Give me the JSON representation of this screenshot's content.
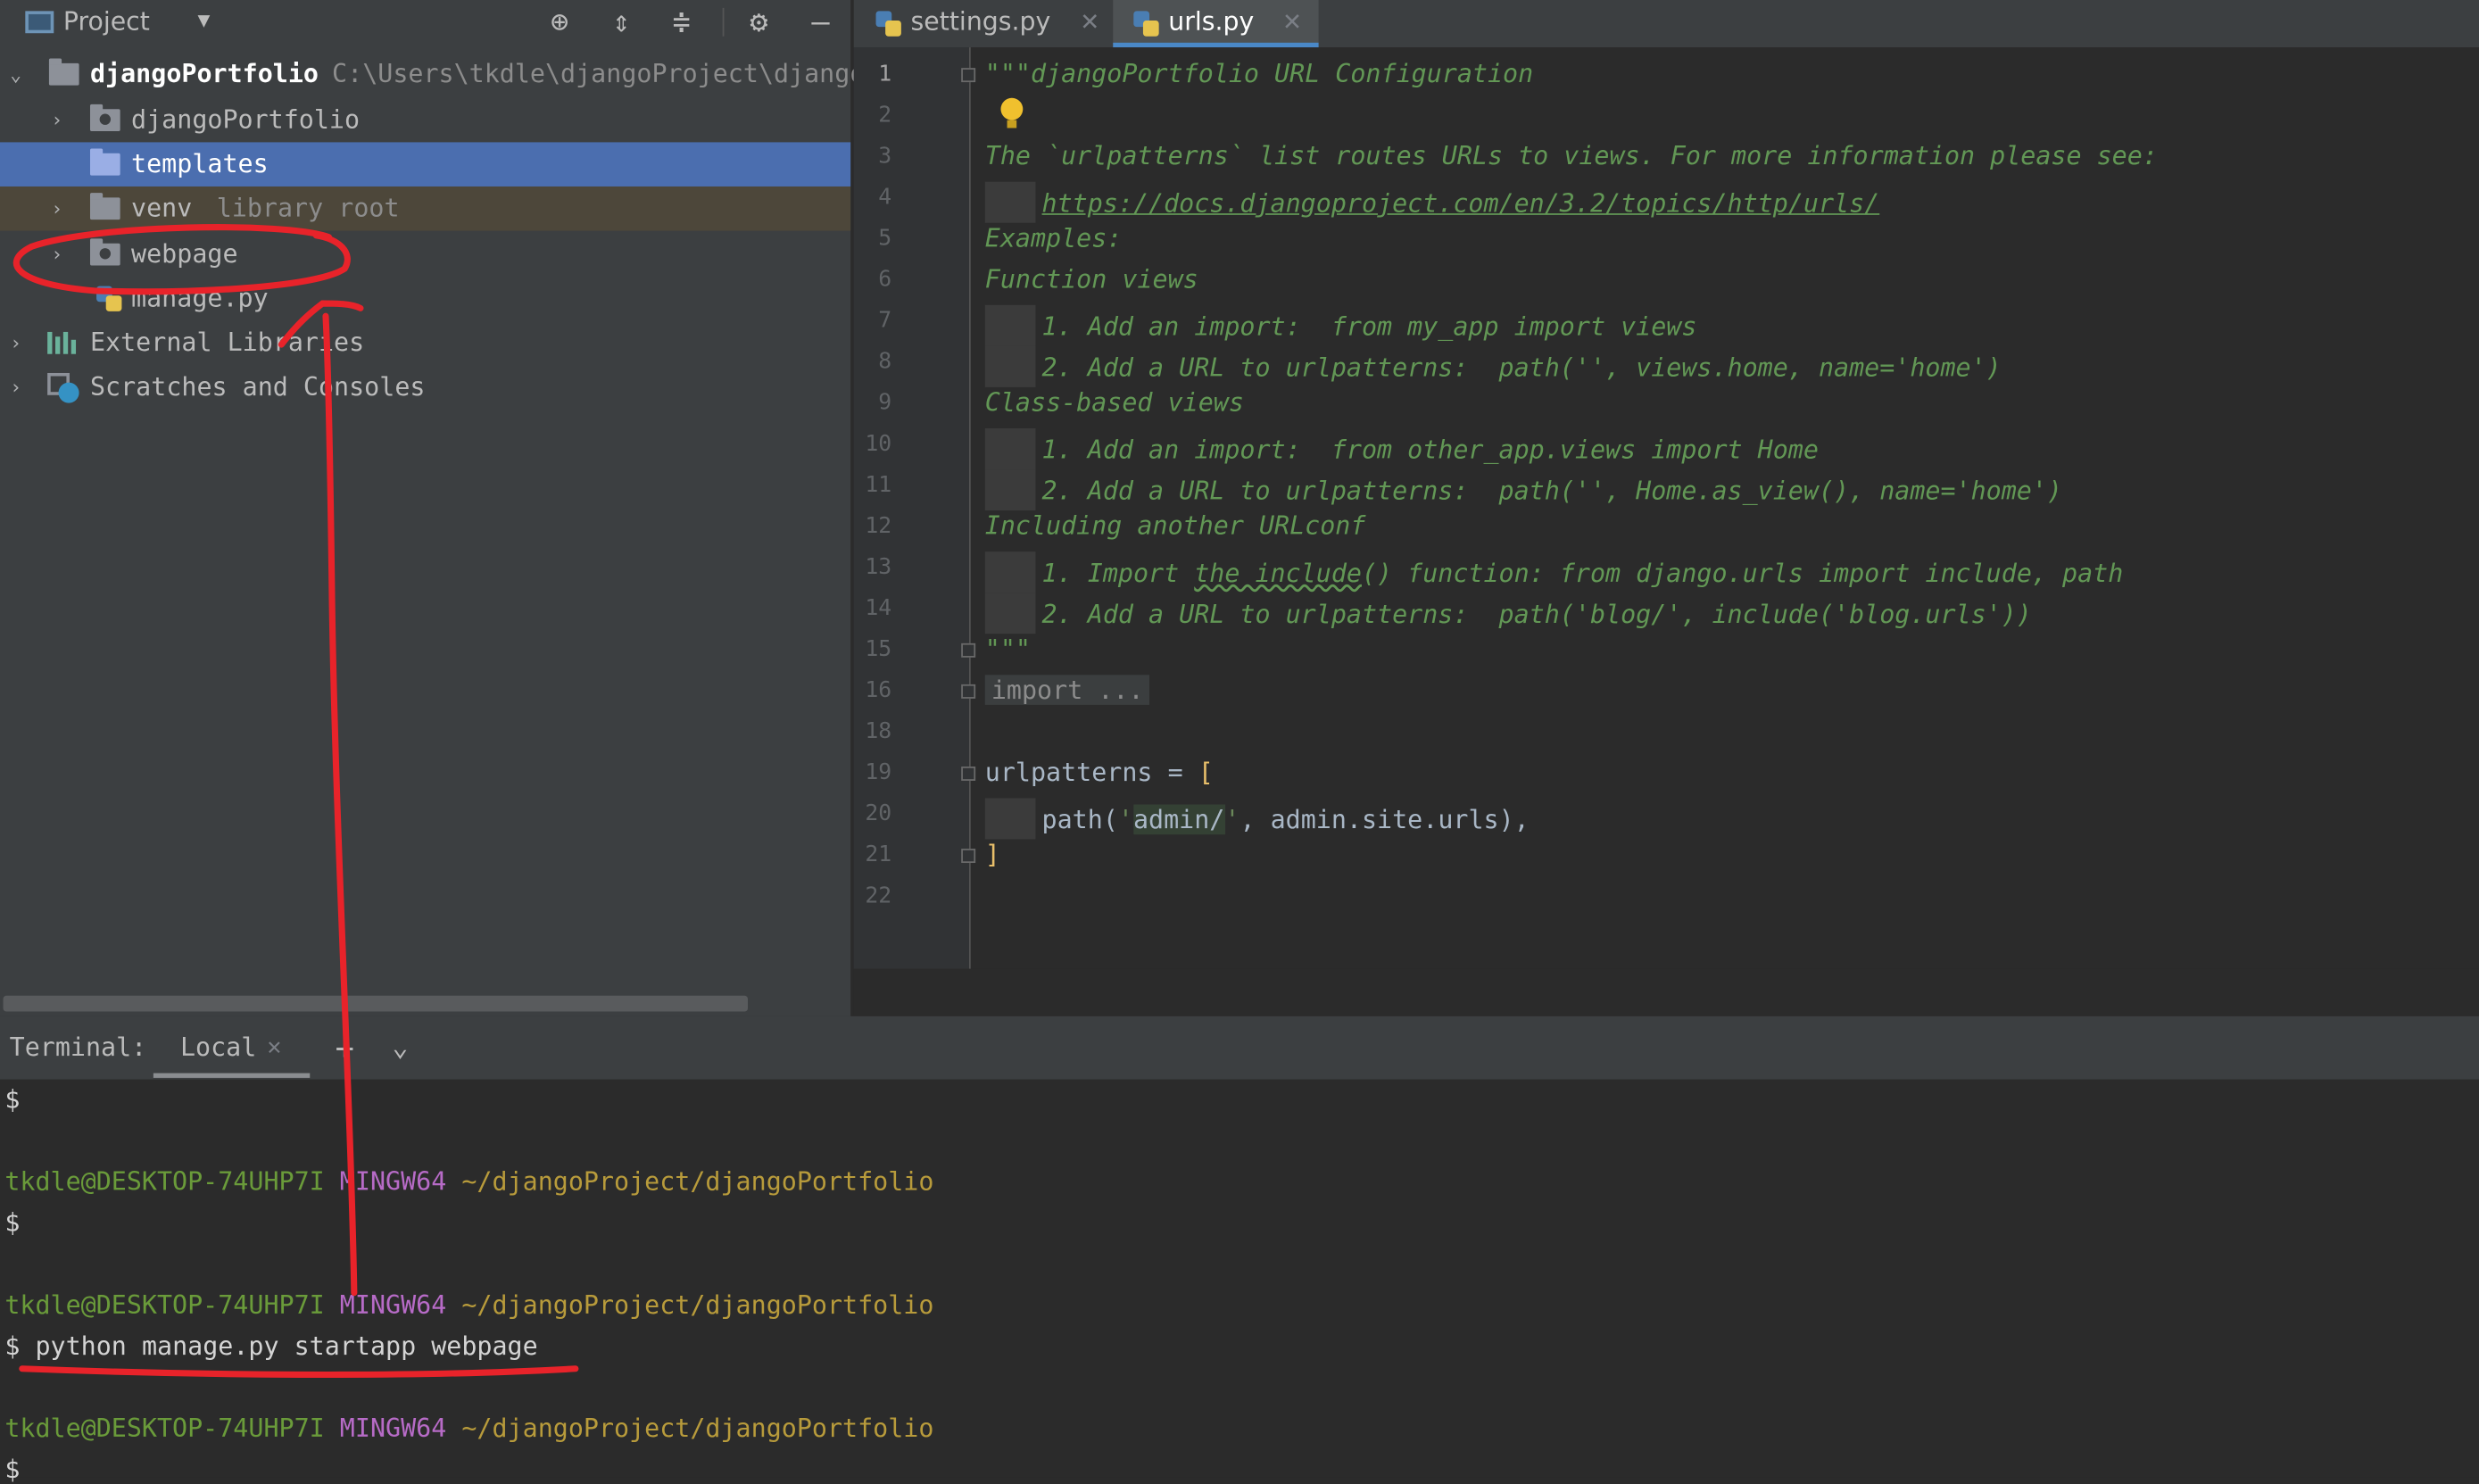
{
  "project": {
    "title": "Project",
    "tree": [
      {
        "label": "djangoPortfolio",
        "hint": "C:\\Users\\tkdle\\djangoProject\\djangoPo"
      },
      {
        "label": "djangoPortfolio"
      },
      {
        "label": "templates"
      },
      {
        "label": "venv",
        "hint": "library root"
      },
      {
        "label": "webpage"
      },
      {
        "label": "manage.py"
      },
      {
        "label": "External Libraries"
      },
      {
        "label": "Scratches and Consoles"
      }
    ]
  },
  "editor": {
    "tabs": [
      {
        "label": "settings.py"
      },
      {
        "label": "urls.py"
      }
    ],
    "line_numbers": [
      "1",
      "2",
      "3",
      "4",
      "5",
      "6",
      "7",
      "8",
      "9",
      "10",
      "11",
      "12",
      "13",
      "14",
      "15",
      "16",
      "18",
      "19",
      "20",
      "21",
      "22"
    ],
    "code": {
      "l1": "\"\"\"djangoPortfolio URL Configuration",
      "l3": "The `urlpatterns` list routes URLs to views. For more information please see:",
      "l4": "https://docs.djangoproject.com/en/3.2/topics/http/urls/",
      "l5": "Examples:",
      "l6": "Function views",
      "l7": "1. Add an import:  from my_app import views",
      "l8": "2. Add a URL to urlpatterns:  path('', views.home, name='home')",
      "l9": "Class-based views",
      "l10": "1. Add an import:  from other_app.views import Home",
      "l11": "2. Add a URL to urlpatterns:  path('', Home.as_view(), name='home')",
      "l12": "Including another URLconf",
      "l13a": "1. Import ",
      "l13b": "the include",
      "l13c": "() function: from django.urls import include, path",
      "l14": "2. Add a URL to urlpatterns:  path('blog/', include('blog.urls'))",
      "l15": "\"\"\"",
      "l16": "import ...",
      "l19a": "urlpatterns = ",
      "l19b": "[",
      "l20a": "path(",
      "l20b": "'",
      "l20c": "admin/",
      "l20d": "'",
      "l20e": ", admin.site.urls),",
      "l21": "]"
    }
  },
  "terminal": {
    "title": "Terminal:",
    "tab": "Local",
    "prompt": "$",
    "user": "tkdle@DESKTOP-74UHP7I",
    "sys": "MINGW64",
    "path": "~/djangoProject/djangoPortfolio",
    "command": "python manage.py startapp webpage"
  },
  "colors": {
    "annotation": "#e8232a",
    "selection": "#4b6eaf",
    "docstring": "#629755"
  }
}
